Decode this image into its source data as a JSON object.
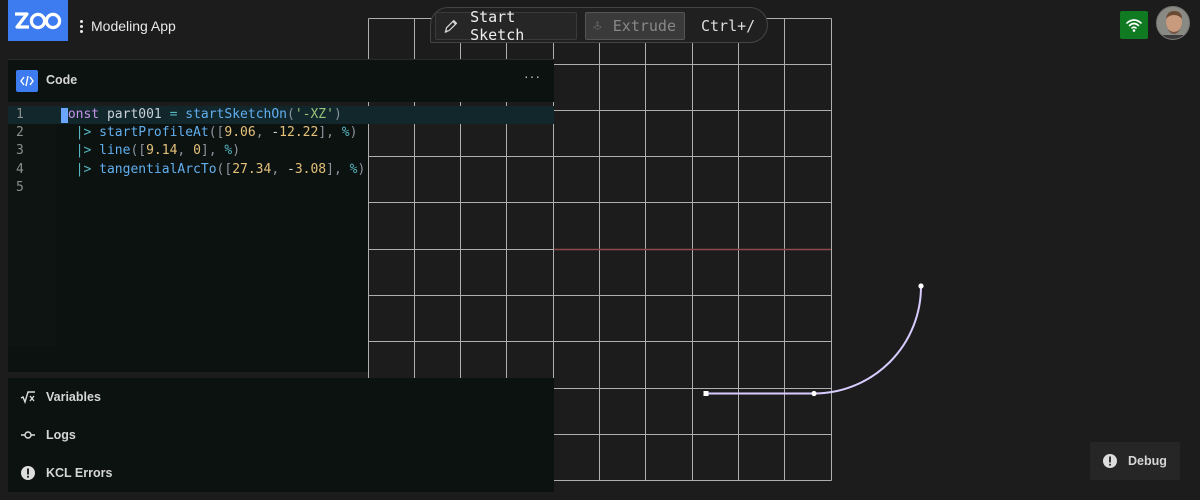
{
  "header": {
    "logo_text": "ZOO",
    "app_name": "Modeling App",
    "toolbar": {
      "start_sketch": "Start Sketch",
      "extrude": "Extrude",
      "shortcut": "Ctrl+/"
    },
    "network_status_color": "#0f7a22"
  },
  "code_pane": {
    "title": "Code",
    "menu_label": "···",
    "line_numbers": [
      "1",
      "2",
      "3",
      "4",
      "5"
    ],
    "lines": [
      "const part001 = startSketchOn('-XZ')",
      "  |> startProfileAt([9.06, -12.22], %)",
      "  |> line([9.14, 0], %)",
      "  |> tangentialArcTo([27.34, -3.08], %)",
      ""
    ]
  },
  "panels": {
    "variables": "Variables",
    "logs": "Logs",
    "kcl_errors": "KCL Errors"
  },
  "debug": {
    "label": "Debug"
  },
  "colors": {
    "accent": "#3d7bf0",
    "background": "#1c1c1c",
    "grid_line": "#c8c8c8",
    "axis_line": "#8a4a4a",
    "sketch_path": "#c8b8ff"
  }
}
